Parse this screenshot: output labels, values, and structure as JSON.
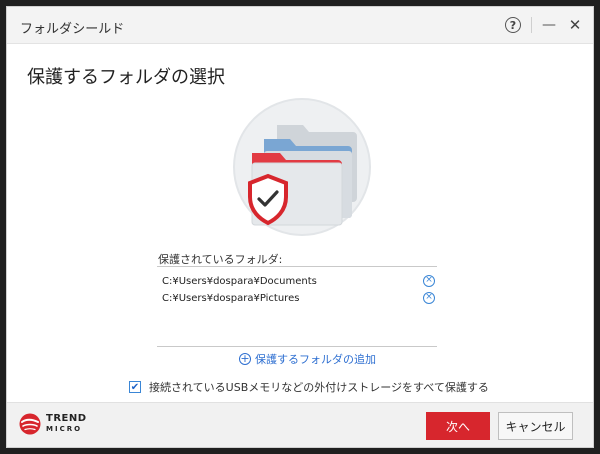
{
  "window": {
    "title": "フォルダシールド",
    "controls": {
      "help_icon": "help-icon",
      "help_glyph": "?",
      "minimize_glyph": "—",
      "close_glyph": "✕"
    }
  },
  "main": {
    "heading": "保護するフォルダの選択",
    "hero_icon": "folder-shield-illustration",
    "protected_label": "保護されているフォルダ:",
    "folders": [
      {
        "path": "C:¥Users¥dospara¥Documents",
        "remove_icon": "remove-circle-icon"
      },
      {
        "path": "C:¥Users¥dospara¥Pictures",
        "remove_icon": "remove-circle-icon"
      }
    ],
    "add_folder": {
      "icon": "plus-circle-icon",
      "label": "保護するフォルダの追加"
    },
    "usb_option": {
      "checked": true,
      "label": "接続されているUSBメモリなどの外付けストレージをすべて保護する"
    }
  },
  "footer": {
    "logo": {
      "line1": "TREND",
      "line2": "MICRO"
    },
    "next_label": "次へ",
    "cancel_label": "キャンセル"
  },
  "colors": {
    "accent_red": "#d7262d",
    "link_blue": "#2e6fd1",
    "folder_red": "#e23b43",
    "folder_blue": "#7aa6d3"
  }
}
